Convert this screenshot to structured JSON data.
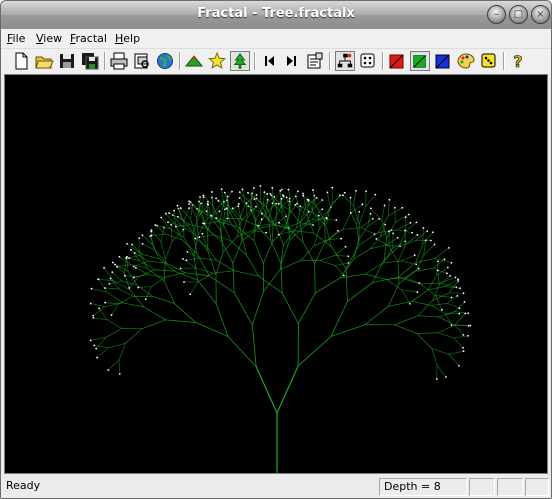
{
  "window": {
    "title": "Fractal - Tree.fractalx"
  },
  "menu": {
    "items": [
      "File",
      "View",
      "Fractal",
      "Help"
    ],
    "mnemonics": [
      "F",
      "V",
      "F",
      "H"
    ]
  },
  "toolbar": {
    "icons": [
      "new-icon",
      "open-icon",
      "save-icon",
      "save-all-icon",
      "print-icon",
      "print-preview-icon",
      "globe-icon",
      "mountain-icon",
      "star-icon",
      "tree-icon",
      "step-back-icon",
      "step-forward-icon",
      "properties-icon",
      "hierarchy-icon",
      "dice-icon",
      "red-color-icon",
      "green-color-icon",
      "blue-color-icon",
      "palette-icon",
      "yellow-dice-icon",
      "help-icon"
    ],
    "active": "tree-icon"
  },
  "status": {
    "ready": "Ready",
    "depth": "Depth = 8"
  },
  "fractal": {
    "depth": 8,
    "trunk_color": "#22c02a",
    "leaf_color": "#ffffff"
  },
  "colors": {
    "canvas_bg": "#000000"
  }
}
